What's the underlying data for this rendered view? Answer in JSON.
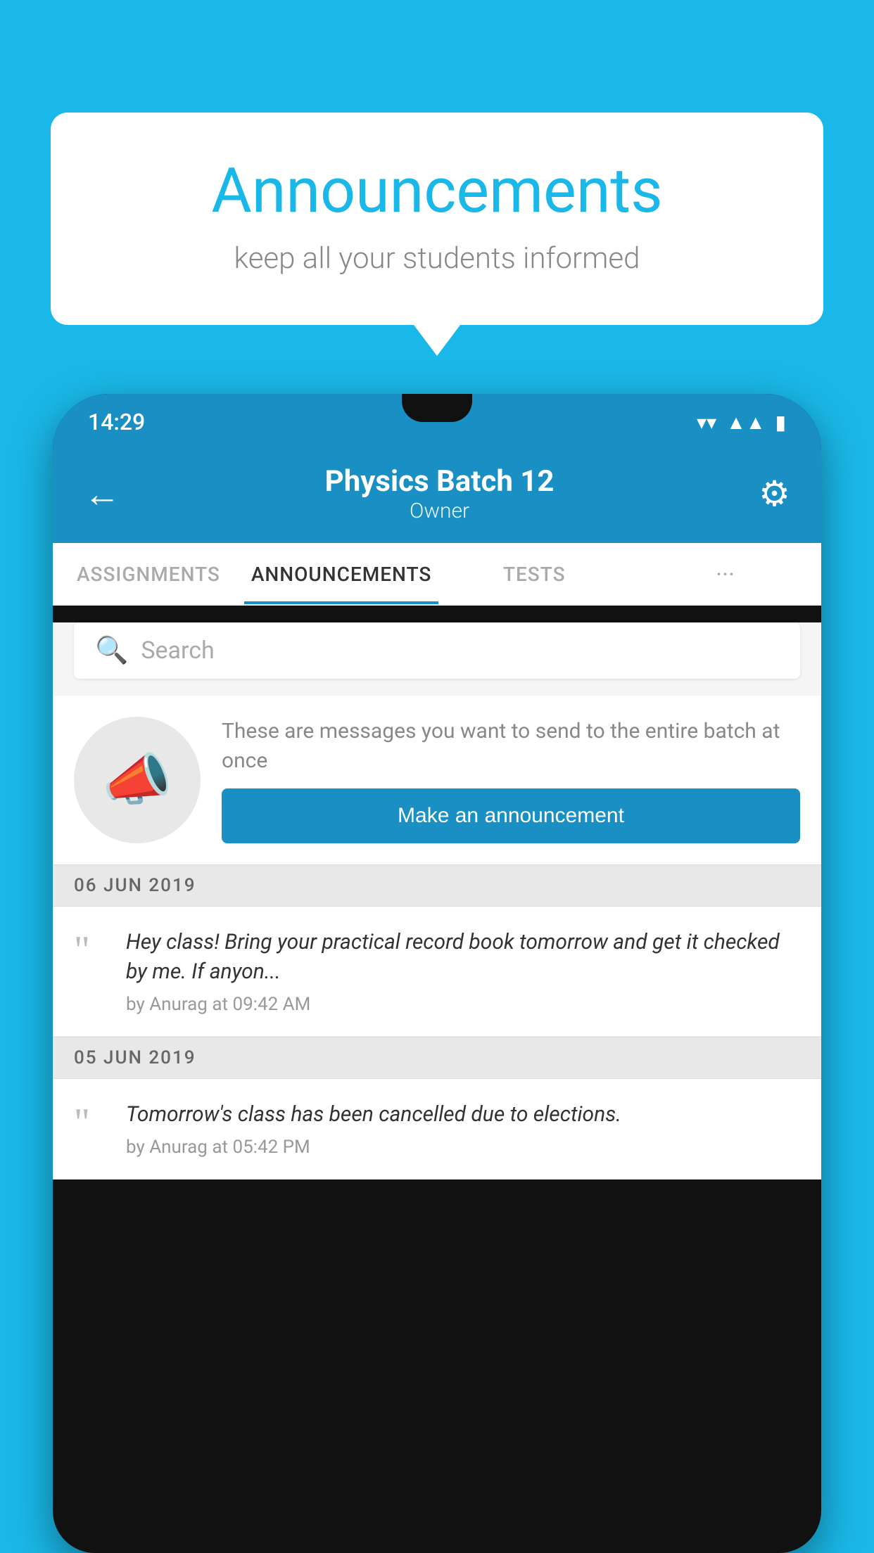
{
  "background_color": "#1ab8e8",
  "speech_bubble": {
    "title": "Announcements",
    "subtitle": "keep all your students informed"
  },
  "phone": {
    "status_bar": {
      "time": "14:29",
      "icons": [
        "wifi",
        "signal",
        "battery"
      ]
    },
    "header": {
      "title": "Physics Batch 12",
      "subtitle": "Owner",
      "back_label": "←",
      "gear_label": "⚙"
    },
    "tabs": [
      {
        "label": "ASSIGNMENTS",
        "active": false
      },
      {
        "label": "ANNOUNCEMENTS",
        "active": true
      },
      {
        "label": "TESTS",
        "active": false
      },
      {
        "label": "···",
        "active": false
      }
    ],
    "search": {
      "placeholder": "Search"
    },
    "promo": {
      "description": "These are messages you want to send to the entire batch at once",
      "button_label": "Make an announcement"
    },
    "announcements": [
      {
        "date": "06  JUN  2019",
        "text": "Hey class! Bring your practical record book tomorrow and get it checked by me. If anyon...",
        "meta": "by Anurag at 09:42 AM"
      },
      {
        "date": "05  JUN  2019",
        "text": "Tomorrow's class has been cancelled due to elections.",
        "meta": "by Anurag at 05:42 PM"
      }
    ]
  }
}
